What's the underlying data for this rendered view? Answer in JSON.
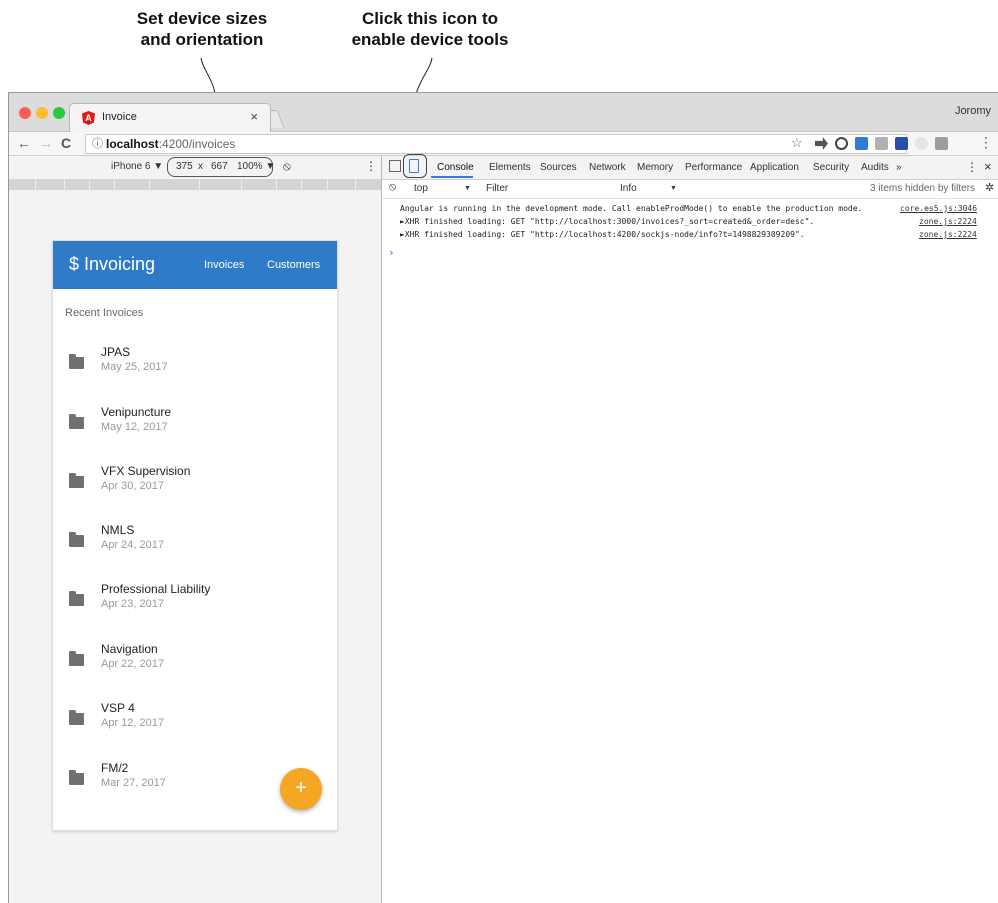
{
  "annotations": {
    "left": {
      "line1": "Set device sizes",
      "line2": "and orientation"
    },
    "right": {
      "line1": "Click this icon to",
      "line2": "enable device tools"
    }
  },
  "browser": {
    "tab_title": "Invoice",
    "tab_close": "×",
    "user_name": "Joromy",
    "nav": {
      "back": "←",
      "forward": "→",
      "reload": "C"
    },
    "url": {
      "info_icon": "ⓘ",
      "host": "localhost",
      "path": ":4200/invoices"
    },
    "star": "☆",
    "menu": "⋮",
    "traffic_colors": [
      "#fd5f57",
      "#febc2e",
      "#28c840"
    ]
  },
  "device_toolbar": {
    "device": "iPhone 6 ▼",
    "width": "375",
    "times": "x",
    "height": "667",
    "zoom": "100% ▼",
    "rotate_icon": "⦸",
    "more": "⋮"
  },
  "app": {
    "brand": "$ Invoicing",
    "nav": [
      "Invoices",
      "Customers"
    ],
    "subheader": "Recent Invoices",
    "invoices": [
      {
        "name": "JPAS",
        "date": "May 25, 2017"
      },
      {
        "name": "Venipuncture",
        "date": "May 12, 2017"
      },
      {
        "name": "VFX Supervision",
        "date": "Apr 30, 2017"
      },
      {
        "name": "NMLS",
        "date": "Apr 24, 2017"
      },
      {
        "name": "Professional Liability",
        "date": "Apr 23, 2017"
      },
      {
        "name": "Navigation",
        "date": "Apr 22, 2017"
      },
      {
        "name": "VSP 4",
        "date": "Apr 12, 2017"
      },
      {
        "name": "FM/2",
        "date": "Mar 27, 2017"
      }
    ],
    "fab": "+",
    "accent": "#2f7bc8",
    "fab_color": "#f5a623"
  },
  "devtools": {
    "tabs": [
      "Console",
      "Elements",
      "Sources",
      "Network",
      "Memory",
      "Performance",
      "Application",
      "Security",
      "Audits",
      "»"
    ],
    "close": "×",
    "more": "⋮",
    "filter": {
      "block_icon": "⦸",
      "context": "top",
      "context_arrow": "▼",
      "placeholder": "Filter",
      "level": "Info",
      "level_arrow": "▼",
      "hidden": "3 items hidden by filters",
      "settings_icon": "✲"
    },
    "console": [
      {
        "text": "Angular is running in the development mode. Call enableProdMode() to enable the production mode.",
        "source": "core.es5.js:3046"
      },
      {
        "text": "►XHR finished loading: GET \"http://localhost:3000/invoices?_sort=created&_order=desc\".",
        "source": "zone.js:2224"
      },
      {
        "text": "►XHR finished loading: GET \"http://localhost:4200/sockjs-node/info?t=1498829309209\".",
        "source": "zone.js:2224"
      }
    ],
    "prompt": "›"
  }
}
